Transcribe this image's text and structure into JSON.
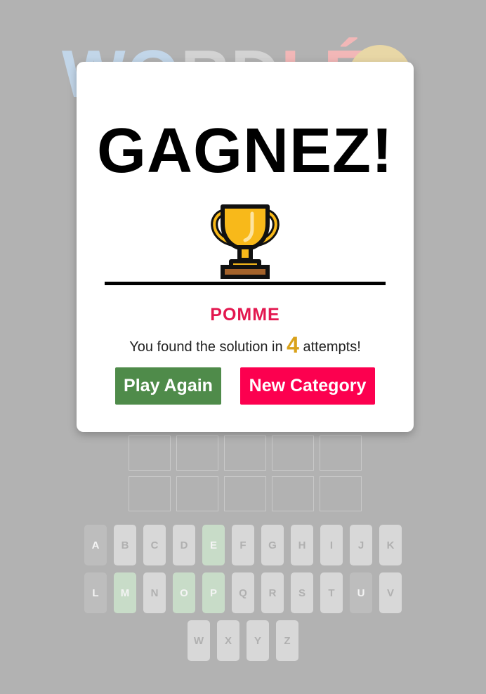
{
  "logo": {
    "letters": [
      "W",
      "O",
      "R",
      "D",
      "L",
      "É"
    ],
    "colors": [
      "#c2d6e9",
      "#c2d6e9",
      "#d3d3d3",
      "#d3d3d3",
      "#f2b7b7",
      "#f2b7b7"
    ]
  },
  "modal": {
    "title": "GAGNEZ!",
    "trophy_icon": "trophy-icon",
    "solution": "POMME",
    "result_prefix": "You found the solution in",
    "attempts": "4",
    "result_suffix": "attempts!",
    "play_again_label": "Play Again",
    "new_category_label": "New Category"
  },
  "grid": {
    "rows": [
      [
        "",
        "",
        "",
        "",
        ""
      ],
      [
        "",
        "",
        "",
        "",
        ""
      ]
    ]
  },
  "keyboard": {
    "rows": [
      [
        {
          "key": "A",
          "state": "absent"
        },
        {
          "key": "B",
          "state": "unused"
        },
        {
          "key": "C",
          "state": "unused"
        },
        {
          "key": "D",
          "state": "unused"
        },
        {
          "key": "E",
          "state": "present"
        },
        {
          "key": "F",
          "state": "unused"
        },
        {
          "key": "G",
          "state": "unused"
        },
        {
          "key": "H",
          "state": "unused"
        },
        {
          "key": "I",
          "state": "unused"
        },
        {
          "key": "J",
          "state": "unused"
        },
        {
          "key": "K",
          "state": "unused"
        }
      ],
      [
        {
          "key": "L",
          "state": "absent"
        },
        {
          "key": "M",
          "state": "present"
        },
        {
          "key": "N",
          "state": "unused"
        },
        {
          "key": "O",
          "state": "present"
        },
        {
          "key": "P",
          "state": "present"
        },
        {
          "key": "Q",
          "state": "unused"
        },
        {
          "key": "R",
          "state": "unused"
        },
        {
          "key": "S",
          "state": "unused"
        },
        {
          "key": "T",
          "state": "unused"
        },
        {
          "key": "U",
          "state": "absent"
        },
        {
          "key": "V",
          "state": "unused"
        }
      ],
      [
        {
          "key": "W",
          "state": "unused"
        },
        {
          "key": "X",
          "state": "unused"
        },
        {
          "key": "Y",
          "state": "unused"
        },
        {
          "key": "Z",
          "state": "unused"
        }
      ]
    ]
  }
}
